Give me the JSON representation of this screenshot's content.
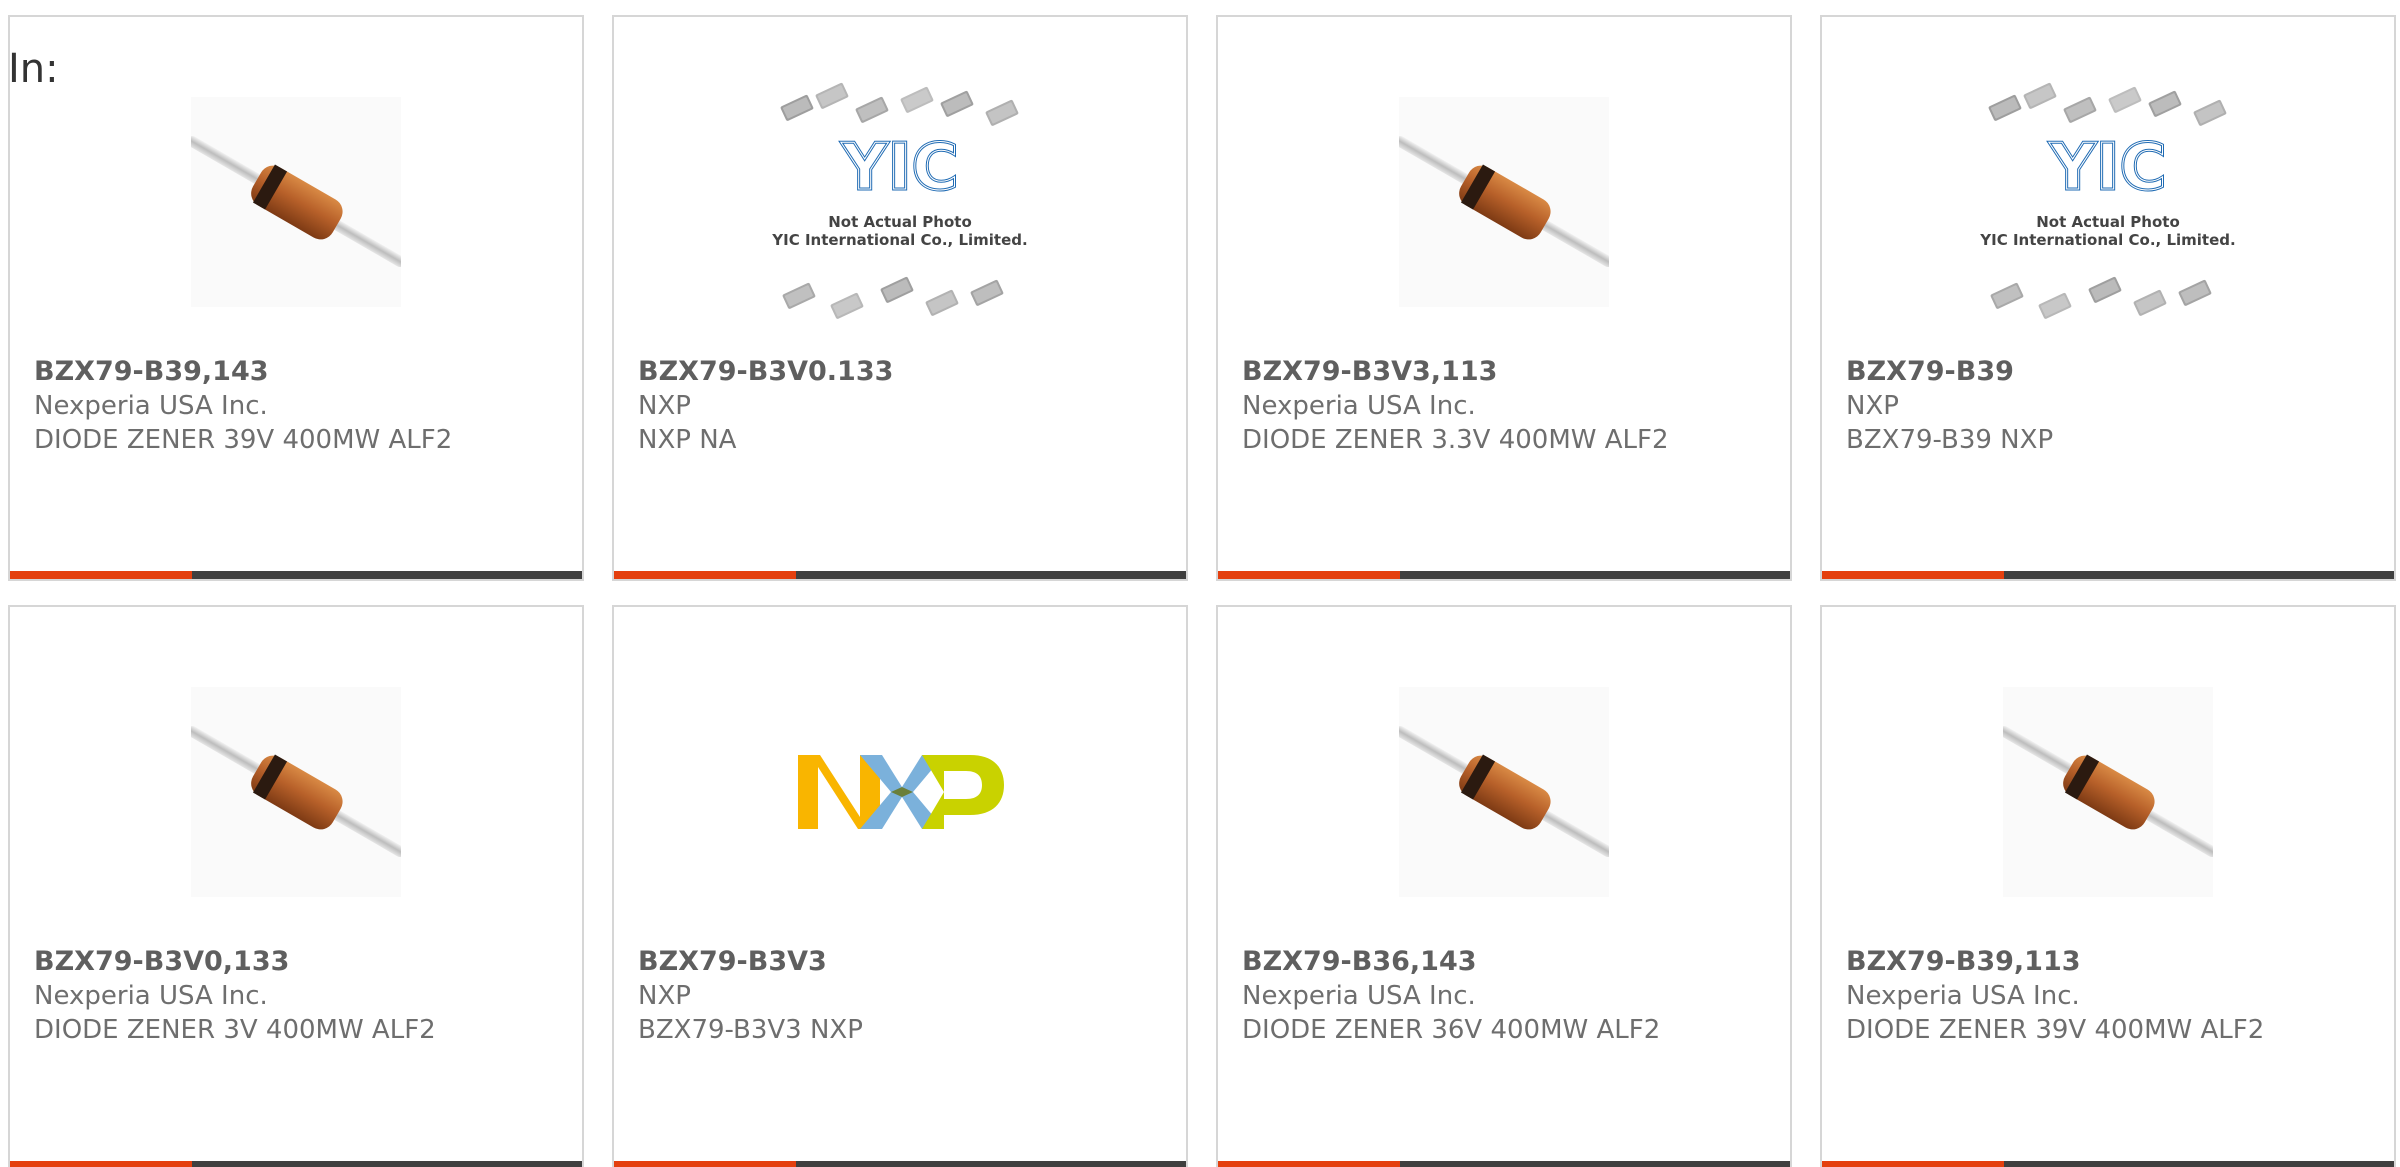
{
  "filter": {
    "in_label": "In:"
  },
  "products": [
    {
      "part_number": "BZX79-B39,143",
      "manufacturer": "Nexperia USA Inc.",
      "description": "DIODE ZENER 39V 400MW ALF2",
      "image": "diode-photo"
    },
    {
      "part_number": "BZX79-B3V0.133",
      "manufacturer": "NXP",
      "description": "NXP NA",
      "image": "yic-placeholder",
      "placeholder_line1": "Not Actual Photo",
      "placeholder_line2": "YIC International Co., Limited.",
      "placeholder_logo": "YIC"
    },
    {
      "part_number": "BZX79-B3V3,113",
      "manufacturer": "Nexperia USA Inc.",
      "description": "DIODE ZENER 3.3V 400MW ALF2",
      "image": "diode-photo"
    },
    {
      "part_number": "BZX79-B39",
      "manufacturer": "NXP",
      "description": "BZX79-B39 NXP",
      "image": "yic-placeholder",
      "placeholder_line1": "Not Actual Photo",
      "placeholder_line2": "YIC International Co., Limited.",
      "placeholder_logo": "YIC"
    },
    {
      "part_number": "BZX79-B3V0,133",
      "manufacturer": "Nexperia USA Inc.",
      "description": "DIODE ZENER 3V 400MW ALF2",
      "image": "diode-photo"
    },
    {
      "part_number": "BZX79-B3V3",
      "manufacturer": "NXP",
      "description": "BZX79-B3V3 NXP",
      "image": "nxp-logo",
      "logo_text": "NXP"
    },
    {
      "part_number": "BZX79-B36,143",
      "manufacturer": "Nexperia USA Inc.",
      "description": "DIODE ZENER 36V 400MW ALF2",
      "image": "diode-photo"
    },
    {
      "part_number": "BZX79-B39,113",
      "manufacturer": "Nexperia USA Inc.",
      "description": "DIODE ZENER 39V 400MW ALF2",
      "image": "diode-photo"
    }
  ],
  "colors": {
    "accent": "#e43f0e",
    "bar": "#3f3f3f",
    "border": "#d6d6d6",
    "part_number": "#5f5f5f",
    "text": "#6e6e6e"
  }
}
